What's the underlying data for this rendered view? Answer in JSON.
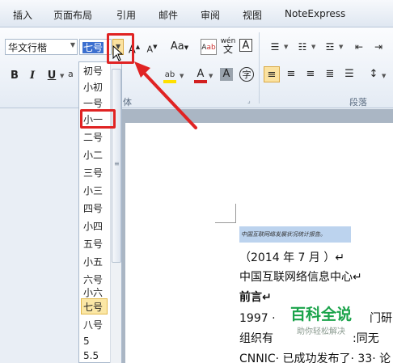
{
  "menu_tabs": [
    "插入",
    "页面布局",
    "引用",
    "邮件",
    "审阅",
    "视图",
    "NoteExpress"
  ],
  "ribbon": {
    "font_name": "华文行楷",
    "font_size": "七号",
    "grow_font_glyph": "A",
    "shrink_font_glyph": "A",
    "change_case_label": "Aa",
    "bold": "B",
    "italic": "I",
    "underline": "U",
    "font_group_label": "体",
    "paragraph_group_label": "段落",
    "wen_label": "wén",
    "char_border": "A",
    "font_color_glyph": "A",
    "char_shading_glyph": "A",
    "enclose_char_glyph": "字"
  },
  "font_size_options": [
    "初号",
    "小初",
    "一号",
    "小一",
    "二号",
    "小二",
    "三号",
    "小三",
    "四号",
    "小四",
    "五号",
    "小五",
    "六号",
    "小六",
    "七号",
    "八号",
    "5",
    "5.5"
  ],
  "selected_size": "七号",
  "document": {
    "line1": "中国互联网络发展状况统计报告。",
    "line2": "（2014 年 7 月 ）↵",
    "line3": "中国互联网络信息中心↵",
    "line4": "前言↵",
    "line5": "1997 · 　　　　　　　　门研",
    "line6": "组织有　　　　　　　:同无",
    "line7": "CNNIC· 已成功发布了· 33· 论"
  },
  "watermark": {
    "title": "百科全说",
    "subtitle": "助你轻松解决"
  },
  "colors": {
    "highlight_red": "#e02323",
    "selected_item": "#fbe7a5",
    "font_color_bar": "#d22020",
    "highlighter_bar": "#ffe000",
    "watermark_green": "#1aa34a"
  }
}
